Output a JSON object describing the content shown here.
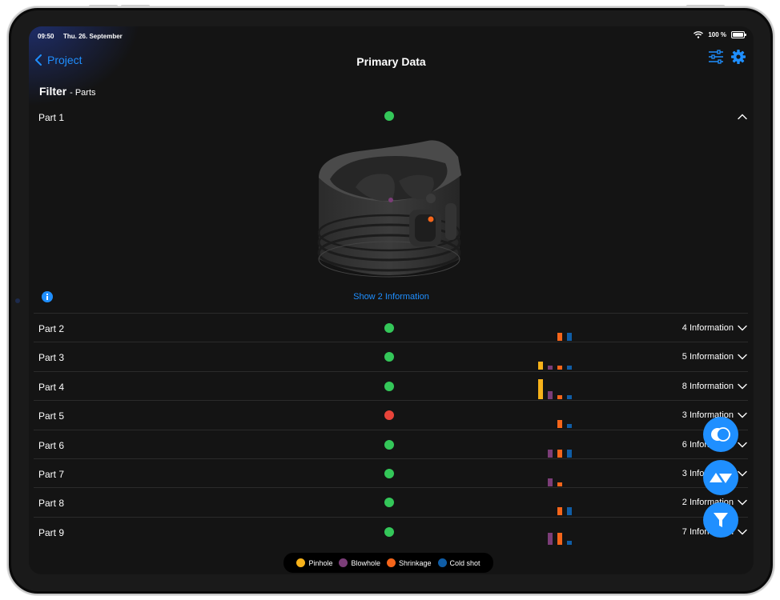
{
  "status_bar": {
    "time": "09:50",
    "date": "Thu. 26. September",
    "battery": "100 %"
  },
  "nav": {
    "back_label": "Project",
    "title": "Primary Data"
  },
  "filter": {
    "title": "Filter",
    "subtitle": "- Parts"
  },
  "colors": {
    "accent": "#1f8fff",
    "ok": "#34c759",
    "error": "#e8443a",
    "pinhole": "#f7b21a",
    "blowhole": "#7b3d78",
    "shrinkage": "#f5651a",
    "cold_shot": "#0f5da6"
  },
  "expanded_part": {
    "label": "Part 1",
    "status": "ok",
    "show_info_label": "Show 2 Information"
  },
  "parts": [
    {
      "label": "Part 2",
      "status": "ok",
      "info": "4 Information",
      "defects": {
        "pinhole": 0,
        "blowhole": 0,
        "shrinkage": 2,
        "cold_shot": 2
      }
    },
    {
      "label": "Part 3",
      "status": "ok",
      "info": "5 Information",
      "defects": {
        "pinhole": 2,
        "blowhole": 1,
        "shrinkage": 1,
        "cold_shot": 1
      }
    },
    {
      "label": "Part 4",
      "status": "ok",
      "info": "8 Information",
      "defects": {
        "pinhole": 5,
        "blowhole": 2,
        "shrinkage": 1,
        "cold_shot": 1
      }
    },
    {
      "label": "Part 5",
      "status": "error",
      "info": "3 Information",
      "defects": {
        "pinhole": 0,
        "blowhole": 0,
        "shrinkage": 2,
        "cold_shot": 1
      }
    },
    {
      "label": "Part 6",
      "status": "ok",
      "info": "6 Information",
      "defects": {
        "pinhole": 0,
        "blowhole": 2,
        "shrinkage": 2,
        "cold_shot": 2
      }
    },
    {
      "label": "Part 7",
      "status": "ok",
      "info": "3 Information",
      "defects": {
        "pinhole": 0,
        "blowhole": 2,
        "shrinkage": 1,
        "cold_shot": 0
      }
    },
    {
      "label": "Part 8",
      "status": "ok",
      "info": "2 Information",
      "defects": {
        "pinhole": 0,
        "blowhole": 0,
        "shrinkage": 2,
        "cold_shot": 2
      }
    },
    {
      "label": "Part 9",
      "status": "ok",
      "info": "7 Information",
      "defects": {
        "pinhole": 0,
        "blowhole": 3,
        "shrinkage": 3,
        "cold_shot": 1
      }
    }
  ],
  "legend": [
    {
      "key": "pinhole",
      "label": "Pinhole"
    },
    {
      "key": "blowhole",
      "label": "Blowhole"
    },
    {
      "key": "shrinkage",
      "label": "Shrinkage"
    },
    {
      "key": "cold_shot",
      "label": "Cold shot"
    }
  ],
  "icons": {
    "back": "chevron-left-icon",
    "adjust": "sliders-icon",
    "settings": "gear-icon",
    "compare": "overlap-circles-icon",
    "sort": "sort-triangles-icon",
    "filter": "funnel-icon"
  }
}
